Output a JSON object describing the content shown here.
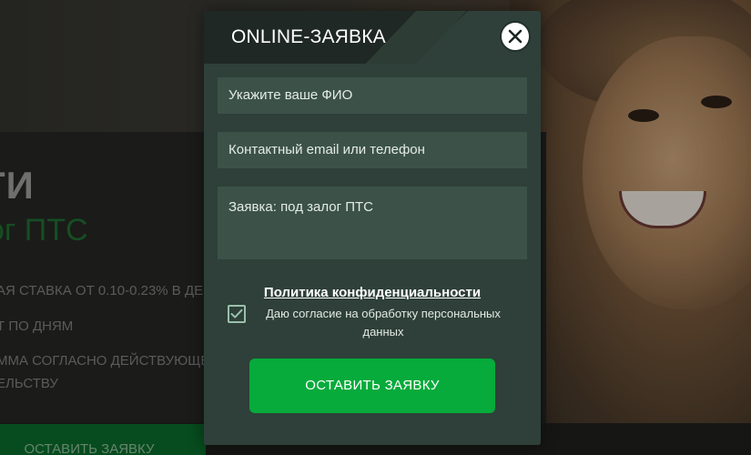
{
  "background": {
    "title": "ТИ",
    "subtitle": "ог ПТС",
    "lines": [
      "АЯ СТАВКА ОТ 0.10-0.23% В ДЕН",
      "Т ПО ДНЯМ",
      "ММА СОГЛАСНО ДЕЙСТВУЮЩЕ",
      "ЕЛЬСТВУ"
    ],
    "button_label": "ОСТАВИТЬ ЗАЯВКУ"
  },
  "modal": {
    "title": "ONLINE-ЗАЯВКА",
    "close_icon": "close-icon",
    "fields": {
      "name_placeholder": "Укажите ваше ФИО",
      "contact_placeholder": "Контактный email или телефон",
      "message_value": "Заявка: под залог ПТС"
    },
    "policy_link": "Политика конфиденциальности",
    "consent": {
      "checked": true,
      "label": "Даю согласие на обработку персональных данных"
    },
    "submit_label": "ОСТАВИТЬ ЗАЯВКУ"
  },
  "colors": {
    "accent": "#06ab3b",
    "modal_bg": "#2e4039",
    "field_bg": "#3c5249"
  }
}
